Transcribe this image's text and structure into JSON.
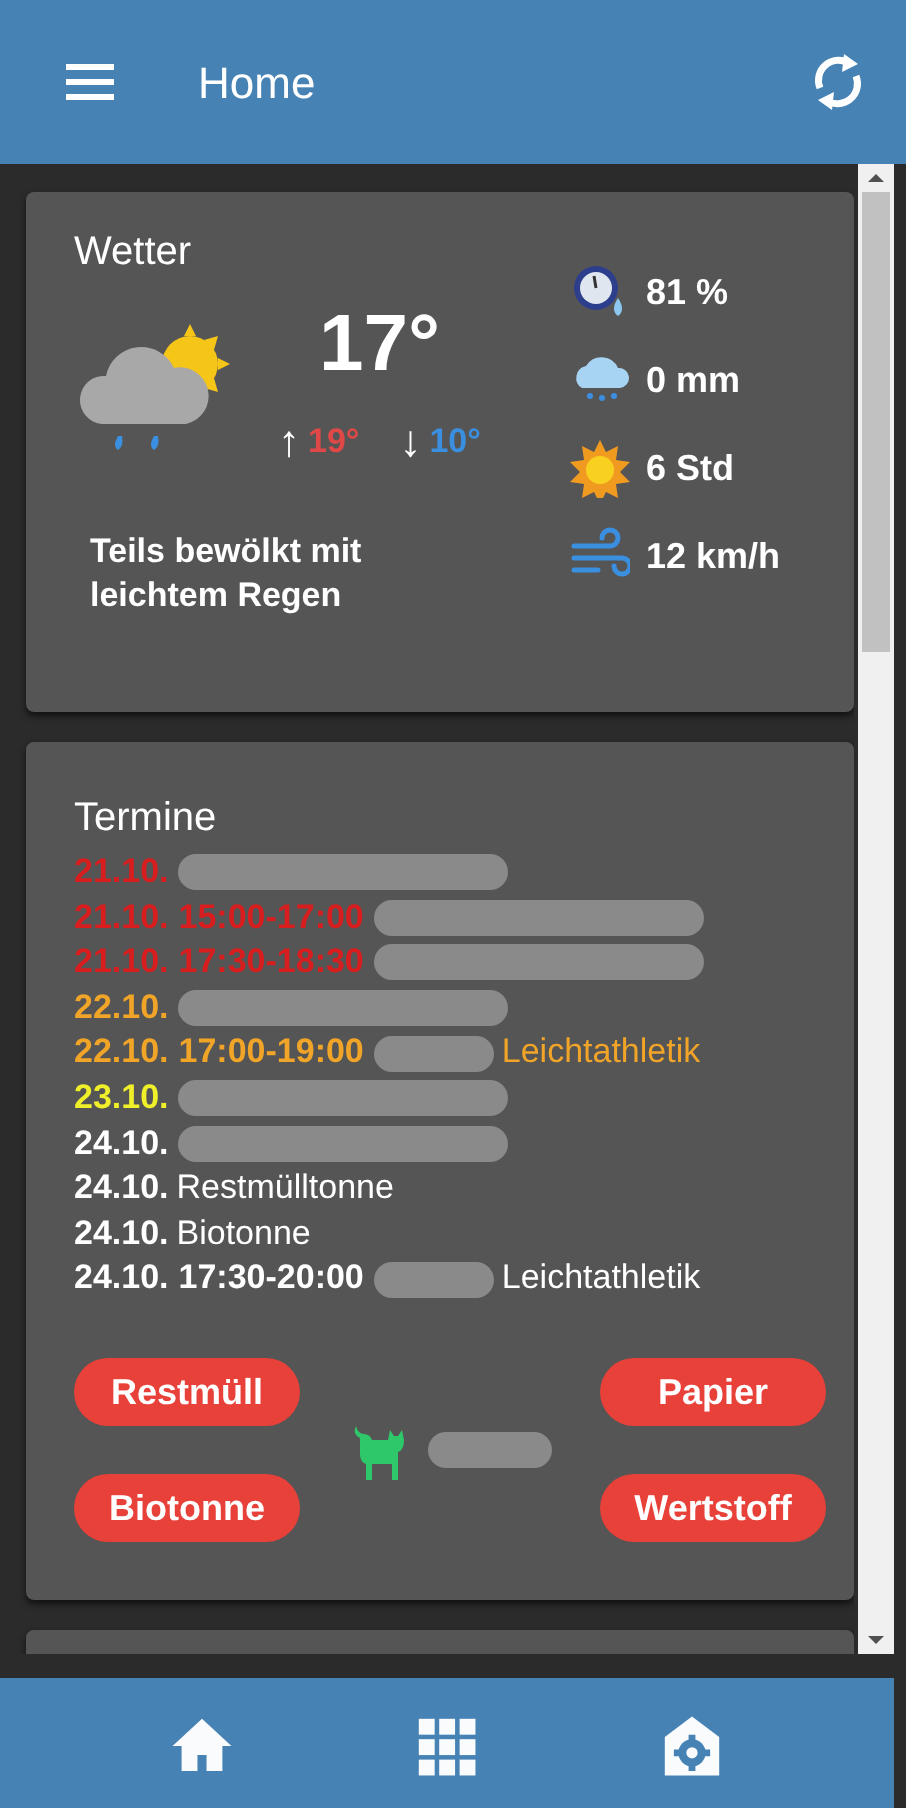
{
  "header": {
    "title": "Home"
  },
  "weather": {
    "title": "Wetter",
    "temperature": "17°",
    "high": "19°",
    "low": "10°",
    "arrow_up": "↑",
    "arrow_down": "↓",
    "description": "Teils bewölkt mit leichtem Regen",
    "stats": [
      {
        "kind": "humidity",
        "value": "81 %"
      },
      {
        "kind": "rain",
        "value": "0 mm"
      },
      {
        "kind": "sun",
        "value": "6 Std"
      },
      {
        "kind": "wind",
        "value": "12 km/h"
      }
    ]
  },
  "appointments": {
    "title": "Termine",
    "events": [
      {
        "date": "21.10.",
        "redacted": true,
        "color": "#d81e1e"
      },
      {
        "date": "21.10.",
        "time": "15:00-17:00",
        "redacted": true,
        "color": "#d81e1e"
      },
      {
        "date": "21.10.",
        "time": "17:30-18:30",
        "redacted": true,
        "color": "#d81e1e"
      },
      {
        "date": "22.10.",
        "redacted": true,
        "color": "#f0a428"
      },
      {
        "date": "22.10.",
        "time": "17:00-19:00",
        "title": "Leichtathletik",
        "redacted": true,
        "color": "#f0a428"
      },
      {
        "date": "23.10.",
        "redacted": true,
        "color": "#f0f02a"
      },
      {
        "date": "24.10.",
        "redacted": true,
        "color": "#ffffff"
      },
      {
        "date": "24.10.",
        "title": "Restmülltonne",
        "redacted": false,
        "color": "#ffffff"
      },
      {
        "date": "24.10.",
        "title": "Biotonne",
        "redacted": false,
        "color": "#ffffff"
      },
      {
        "date": "24.10.",
        "time": "17:30-20:00",
        "title": "Leichtathletik",
        "redacted": true,
        "color": "#ffffff"
      }
    ],
    "bins": [
      {
        "label": "Restmüll"
      },
      {
        "label": "Papier"
      },
      {
        "label": "Biotonne"
      },
      {
        "label": "Wertstoff"
      }
    ],
    "pet_redacted": true
  },
  "bottom_nav": [
    {
      "kind": "home",
      "selected": false
    },
    {
      "kind": "grid",
      "selected": false
    },
    {
      "kind": "settings",
      "selected": false
    }
  ]
}
